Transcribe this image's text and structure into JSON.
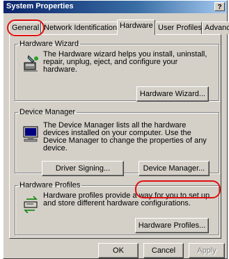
{
  "window": {
    "title": "System Properties",
    "help_label": "?"
  },
  "tabs": [
    {
      "label": "General"
    },
    {
      "label": "Network Identification"
    },
    {
      "label": "Hardware"
    },
    {
      "label": "User Profiles"
    },
    {
      "label": "Advanced"
    }
  ],
  "hardware_wizard": {
    "heading": "Hardware Wizard",
    "description": "The Hardware wizard helps you install, uninstall, repair, unplug, eject, and configure your hardware.",
    "button": "Hardware Wizard..."
  },
  "device_manager": {
    "heading": "Device Manager",
    "description": "The Device Manager lists all the hardware devices installed on your computer. Use the Device Manager to change the properties of any device.",
    "driver_signing_button": "Driver Signing...",
    "device_manager_button": "Device Manager..."
  },
  "hardware_profiles": {
    "heading": "Hardware Profiles",
    "description": "Hardware profiles provide a way for you to set up and store different hardware configurations.",
    "button": "Hardware Profiles..."
  },
  "footer": {
    "ok": "OK",
    "cancel": "Cancel",
    "apply": "Apply"
  },
  "colors": {
    "titlebar": "#0a246a",
    "face": "#d4d0c8",
    "highlight_circle": "#e01010"
  }
}
